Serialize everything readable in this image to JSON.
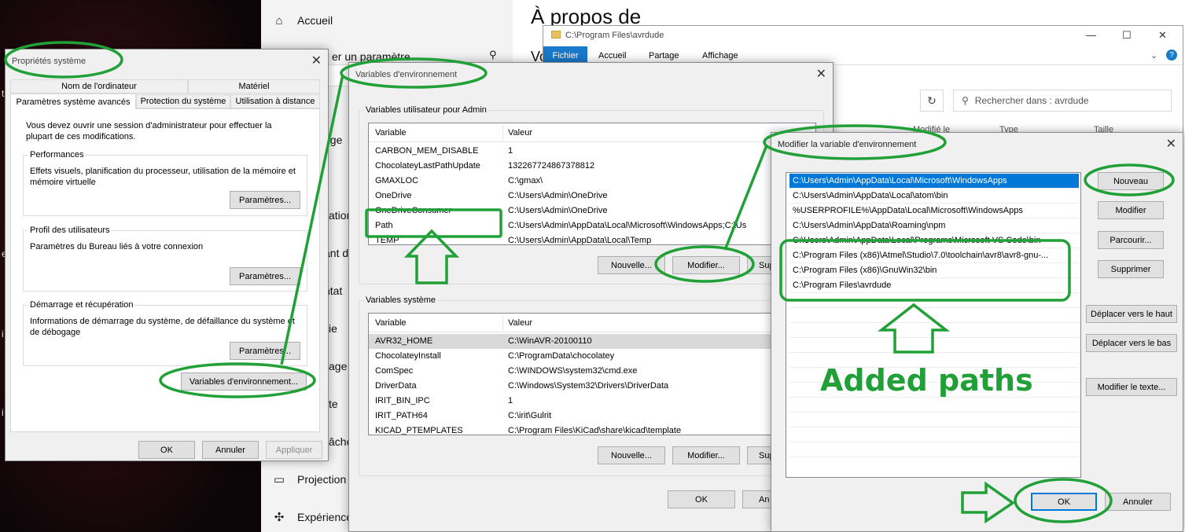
{
  "accent_colors": {
    "annotation_green": "#21a038",
    "selection_blue": "#0078d7",
    "ribbon_blue": "#1979ca"
  },
  "settings": {
    "nav": [
      {
        "label": "Accueil",
        "icon": "home-icon"
      },
      {
        "label": "Projection",
        "icon": "projection-icon"
      },
      {
        "label": "Expériences partagées",
        "icon": "shared-experiences-icon"
      }
    ],
    "search_fragment": "er un paramètre",
    "page_title_fragment": "À propos de",
    "fragments": [
      "age",
      "ation",
      "ant d",
      "ntat",
      "ie",
      "age",
      "te",
      "âche",
      "Vo"
    ]
  },
  "explorer": {
    "title": "C:\\Program Files\\avrdude",
    "ribbon_tabs": [
      "Fichier",
      "Accueil",
      "Partage",
      "Affichage"
    ],
    "search_placeholder": "Rechercher dans : avrdude",
    "columns_fragment": [
      "Modifié le",
      "Type",
      "Taille"
    ]
  },
  "sysprops": {
    "title": "Propriétés système",
    "tabs_row1": [
      "Nom de l'ordinateur",
      "Matériel"
    ],
    "tabs_row2": [
      "Paramètres système avancés",
      "Protection du système",
      "Utilisation à distance"
    ],
    "intro": "Vous devez ouvrir une session d'administrateur pour effectuer la plupart de ces modifications.",
    "performance": {
      "label": "Performances",
      "desc": "Effets visuels, planification du processeur, utilisation de la mémoire et mémoire virtuelle",
      "button": "Paramètres..."
    },
    "profile": {
      "label": "Profil des utilisateurs",
      "desc": "Paramètres du Bureau liés à votre connexion",
      "button": "Paramètres..."
    },
    "startup": {
      "label": "Démarrage et récupération",
      "desc": "Informations de démarrage du système, de défaillance du système et de débogage",
      "button": "Paramètres..."
    },
    "env_button": "Variables d'environnement...",
    "ok": "OK",
    "cancel": "Annuler",
    "apply": "Appliquer"
  },
  "envvars": {
    "title": "Variables d'environnement",
    "user_label": "Variables utilisateur pour Admin",
    "col_variable": "Variable",
    "col_value": "Valeur",
    "user_rows": [
      {
        "name": "CARBON_MEM_DISABLE",
        "value": "1"
      },
      {
        "name": "ChocolateyLastPathUpdate",
        "value": "132267724867378812"
      },
      {
        "name": "GMAXLOC",
        "value": "C:\\gmax\\"
      },
      {
        "name": "OneDrive",
        "value": "C:\\Users\\Admin\\OneDrive"
      },
      {
        "name": "OneDriveConsumer",
        "value": "C:\\Users\\Admin\\OneDrive"
      },
      {
        "name": "Path",
        "value": "C:\\Users\\Admin\\AppData\\Local\\Microsoft\\WindowsApps;C:\\Us"
      },
      {
        "name": "TEMP",
        "value": "C:\\Users\\Admin\\AppData\\Local\\Temp"
      }
    ],
    "user_buttons": [
      "Nouvelle...",
      "Modifier...",
      "Sup"
    ],
    "system_label": "Variables système",
    "system_rows": [
      {
        "name": "AVR32_HOME",
        "value": "C:\\WinAVR-20100110"
      },
      {
        "name": "ChocolateyInstall",
        "value": "C:\\ProgramData\\chocolatey"
      },
      {
        "name": "ComSpec",
        "value": "C:\\WINDOWS\\system32\\cmd.exe"
      },
      {
        "name": "DriverData",
        "value": "C:\\Windows\\System32\\Drivers\\DriverData"
      },
      {
        "name": "IRIT_BIN_IPC",
        "value": "1"
      },
      {
        "name": "IRIT_PATH64",
        "value": "C:\\irit\\Gulrit"
      },
      {
        "name": "KICAD_PTEMPLATES",
        "value": "C:\\Program Files\\KiCad\\share\\kicad\\template"
      }
    ],
    "system_buttons": [
      "Nouvelle...",
      "Modifier...",
      "Sup"
    ],
    "ok": "OK",
    "cancel_fragment": "An"
  },
  "editvar": {
    "title": "Modifier la variable d'environnement",
    "paths": [
      "C:\\Users\\Admin\\AppData\\Local\\Microsoft\\WindowsApps",
      "C:\\Users\\Admin\\AppData\\Local\\atom\\bin",
      "%USERPROFILE%\\AppData\\Local\\Microsoft\\WindowsApps",
      "C:\\Users\\Admin\\AppData\\Roaming\\npm",
      "C:\\Users\\Admin\\AppData\\Local\\Programs\\Microsoft VS Code\\bin",
      "C:\\Program Files (x86)\\Atmel\\Studio\\7.0\\toolchain\\avr8\\avr8-gnu-...",
      "C:\\Program Files (x86)\\GnuWin32\\bin",
      "C:\\Program Files\\avrdude"
    ],
    "buttons": [
      "Nouveau",
      "Modifier",
      "Parcourir...",
      "Supprimer",
      "Déplacer vers le haut",
      "Déplacer vers le bas",
      "Modifier le texte..."
    ],
    "ok": "OK",
    "cancel": "Annuler"
  },
  "annotation": {
    "label": "Added paths"
  }
}
